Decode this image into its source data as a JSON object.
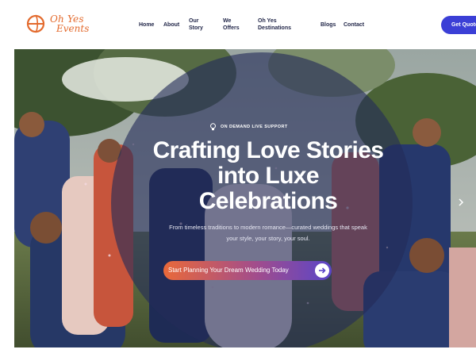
{
  "brand": {
    "logo_line1": "Oh Yes",
    "logo_line2": "Events",
    "logo_mark_icon": "event-mark-icon",
    "accent_color": "#e36a2d"
  },
  "nav": {
    "items": [
      {
        "label": "Home"
      },
      {
        "label": "About"
      },
      {
        "label": "Our Story"
      },
      {
        "label": "We Offers"
      },
      {
        "label": "Oh Yes Destinations"
      },
      {
        "label": "Blogs"
      },
      {
        "label": "Contact"
      }
    ],
    "cta_label": "Get Quote",
    "cta_color": "#3b3fd6"
  },
  "hero": {
    "support_icon": "lightbulb-icon",
    "support_text": "ON DEMAND LIVE SUPPORT",
    "title": "Crafting Love Stories into Luxe Celebrations",
    "subtitle": "From timeless traditions to modern romance—curated weddings that speak your style, your story, your soul.",
    "cta_label": "Start Planning Your Dream Wedding Today",
    "cta_icon": "arrow-right-icon",
    "next_icon": "chevron-right-icon",
    "overlay_color": "#242c58"
  }
}
